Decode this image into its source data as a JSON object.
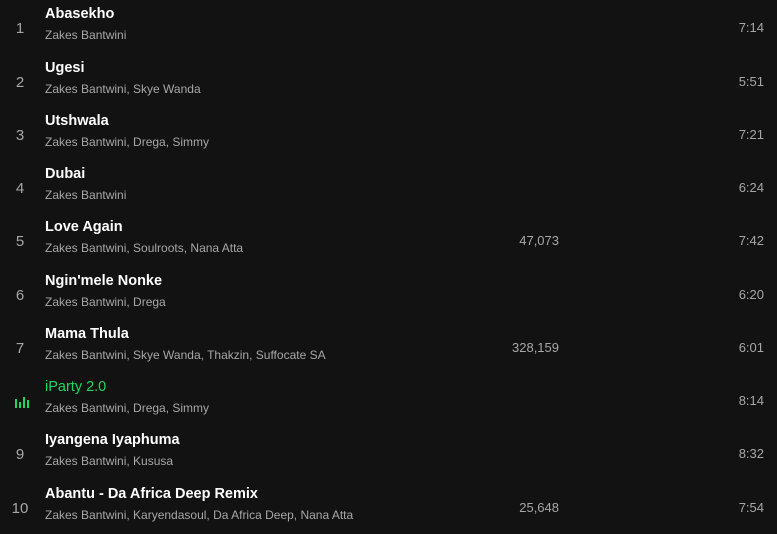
{
  "tracks": [
    {
      "number": "1",
      "title": "Abasekho",
      "artists": "Zakes Bantwini",
      "plays": "",
      "duration": "7:14"
    },
    {
      "number": "2",
      "title": "Ugesi",
      "artists": "Zakes Bantwini, Skye Wanda",
      "plays": "",
      "duration": "5:51"
    },
    {
      "number": "3",
      "title": "Utshwala",
      "artists": "Zakes Bantwini, Drega, Simmy",
      "plays": "",
      "duration": "7:21"
    },
    {
      "number": "4",
      "title": "Dubai",
      "artists": "Zakes Bantwini",
      "plays": "",
      "duration": "6:24"
    },
    {
      "number": "5",
      "title": "Love Again",
      "artists": "Zakes Bantwini, Soulroots, Nana Atta",
      "plays": "47,073",
      "duration": "7:42"
    },
    {
      "number": "6",
      "title": "Ngin'mele Nonke",
      "artists": "Zakes Bantwini, Drega",
      "plays": "",
      "duration": "6:20"
    },
    {
      "number": "7",
      "title": "Mama Thula",
      "artists": "Zakes Bantwini, Skye Wanda, Thakzin, Suffocate SA",
      "plays": "328,159",
      "duration": "6:01"
    },
    {
      "number": "",
      "title": "iParty 2.0",
      "artists": "Zakes Bantwini, Drega, Simmy",
      "plays": "",
      "duration": "8:14",
      "playing": true,
      "icon": "equalizer-icon"
    },
    {
      "number": "9",
      "title": "Iyangena Iyaphuma",
      "artists": "Zakes Bantwini, Kususa",
      "plays": "",
      "duration": "8:32"
    },
    {
      "number": "10",
      "title": "Abantu - Da Africa Deep Remix",
      "artists": "Zakes Bantwini, Karyendasoul, Da Africa Deep, Nana Atta",
      "plays": "25,648",
      "duration": "7:54"
    }
  ],
  "colors": {
    "background": "#121212",
    "title": "#ffffff",
    "secondary": "#a7a7a7",
    "playing": "#1ed760"
  }
}
